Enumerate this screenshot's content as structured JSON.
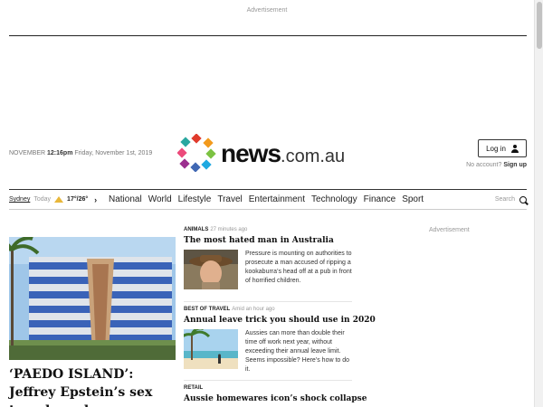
{
  "ads": {
    "top_label": "Advertisement",
    "side_label": "Advertisement"
  },
  "date_line": {
    "month": "NOVEMBER",
    "time": "12:16pm",
    "date": "Friday, November 1st, 2019"
  },
  "logo": {
    "word": "news",
    "domain": ".com.au",
    "dot_colors": [
      "#e03b2c",
      "#f29a1d",
      "#7cc242",
      "#1fa9e1",
      "#4068b3",
      "#9c2f8f",
      "#ec4a7b",
      "#2aa7a0"
    ]
  },
  "account": {
    "login_label": "Log in",
    "no_account": "No account?",
    "signup": "Sign up"
  },
  "weather": {
    "city": "Sydney",
    "when": "Today",
    "temps": "17°/26°"
  },
  "nav": {
    "links": [
      "National",
      "World",
      "Lifestyle",
      "Travel",
      "Entertainment",
      "Technology",
      "Finance",
      "Sport"
    ],
    "search_label": "Search"
  },
  "hero": {
    "title": "‘PAEDO ISLAND’: Jeffrey Epstein’s sex temple and"
  },
  "stories": [
    {
      "tag": "Animals",
      "ago": "27 minutes ago",
      "headline": "The most hated man in Australia",
      "blurb": "Pressure is mounting on authorities to prosecute a man accused of ripping a kookaburra’s head off at a pub in front of horrified children."
    },
    {
      "tag": "Best of Travel",
      "ago": "Amid an hour ago",
      "headline": "Annual leave trick you should use in 2020",
      "blurb": "Aussies can more than double their time off work next year, without exceeding their annual leave limit. Seems impossible? Here’s how to do it."
    },
    {
      "tag": "Retail",
      "ago": "",
      "headline": "Aussie homewares icon’s shock collapse",
      "blurb": ""
    }
  ]
}
